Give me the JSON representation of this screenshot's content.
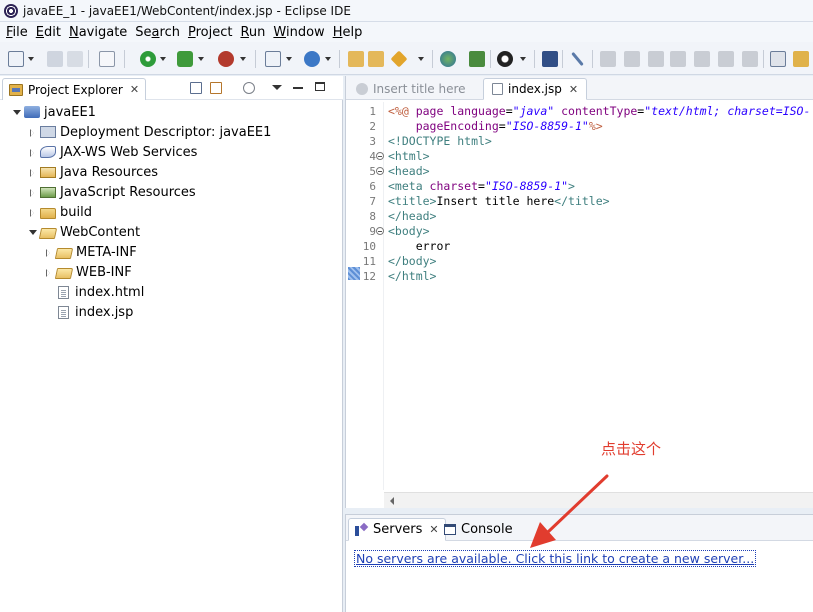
{
  "window": {
    "title": "javaEE_1 - javaEE1/WebContent/index.jsp - Eclipse IDE"
  },
  "menu": [
    {
      "label": "File",
      "mnemonic": "F",
      "rest": "ile"
    },
    {
      "label": "Edit",
      "mnemonic": "E",
      "rest": "dit"
    },
    {
      "label": "Navigate",
      "mnemonic": "N",
      "rest": "avigate"
    },
    {
      "label": "Search",
      "mnemonic": "a",
      "rest": "Se|rch"
    },
    {
      "label": "Project",
      "mnemonic": "P",
      "rest": "roject"
    },
    {
      "label": "Run",
      "mnemonic": "R",
      "rest": "un"
    },
    {
      "label": "Window",
      "mnemonic": "W",
      "rest": "indow"
    },
    {
      "label": "Help",
      "mnemonic": "H",
      "rest": "elp"
    }
  ],
  "explorer": {
    "tab_label": "Project Explorer",
    "close": "✕",
    "tree": [
      {
        "label": "javaEE1",
        "level": 0,
        "twisty": "open",
        "icon": "project-icon"
      },
      {
        "label": "Deployment Descriptor: javaEE1",
        "level": 1,
        "twisty": "closed",
        "icon": "deployment-descriptor-icon"
      },
      {
        "label": "JAX-WS Web Services",
        "level": 1,
        "twisty": "closed",
        "icon": "web-services-icon"
      },
      {
        "label": "Java Resources",
        "level": 1,
        "twisty": "closed",
        "icon": "java-resources-icon"
      },
      {
        "label": "JavaScript Resources",
        "level": 1,
        "twisty": "closed",
        "icon": "javascript-resources-icon"
      },
      {
        "label": "build",
        "level": 1,
        "twisty": "closed",
        "icon": "folder-icon"
      },
      {
        "label": "WebContent",
        "level": 1,
        "twisty": "open",
        "icon": "folder-open-icon"
      },
      {
        "label": "META-INF",
        "level": 2,
        "twisty": "closed",
        "icon": "folder-icon"
      },
      {
        "label": "WEB-INF",
        "level": 2,
        "twisty": "closed",
        "icon": "folder-icon"
      },
      {
        "label": "index.html",
        "level": 2,
        "twisty": "none",
        "icon": "file-icon"
      },
      {
        "label": "index.jsp",
        "level": 2,
        "twisty": "none",
        "icon": "file-icon"
      }
    ]
  },
  "editor": {
    "tabs": [
      {
        "label": "Insert title here",
        "state": "inactive"
      },
      {
        "label": "index.jsp",
        "state": "active"
      }
    ],
    "close": "✕",
    "lines": [
      {
        "n": "1"
      },
      {
        "n": "2"
      },
      {
        "n": "3"
      },
      {
        "n": "4",
        "fold": true
      },
      {
        "n": "5",
        "fold": true
      },
      {
        "n": "6"
      },
      {
        "n": "7"
      },
      {
        "n": "8"
      },
      {
        "n": "9",
        "fold": true
      },
      {
        "n": "10"
      },
      {
        "n": "11"
      },
      {
        "n": "12"
      }
    ],
    "code": {
      "l1_open": "<%@ ",
      "l1_page": "page ",
      "l1_lang_attr": "language",
      "l1_lang_val": "\"java\"",
      "l1_ct_attr": " contentType",
      "l1_ct_val": "\"text/html; charset=ISO-",
      "l2_pe_attr": "    pageEncoding",
      "l2_pe_val": "\"ISO-8859-1\"",
      "l2_close": "%>",
      "l3": "<!DOCTYPE html>",
      "l4": "<html>",
      "l5": "<head>",
      "l6_open": "<meta ",
      "l6_attr": "charset",
      "l6_val": "\"ISO-8859-1\"",
      "l6_close": ">",
      "l7_open": "<title>",
      "l7_text": "Insert title here",
      "l7_close": "</title>",
      "l8": "</head>",
      "l9": "<body>",
      "l10": "    error",
      "l11": "</body>",
      "l12": "</html>"
    }
  },
  "bottom": {
    "tabs": [
      {
        "label": "Servers",
        "state": "active"
      },
      {
        "label": "Console",
        "state": "inactive"
      }
    ],
    "close": "✕",
    "server_link": "No servers are available. Click this link to create a new server..."
  },
  "annotation": {
    "text": "点击这个",
    "color": "#e13c2e"
  }
}
